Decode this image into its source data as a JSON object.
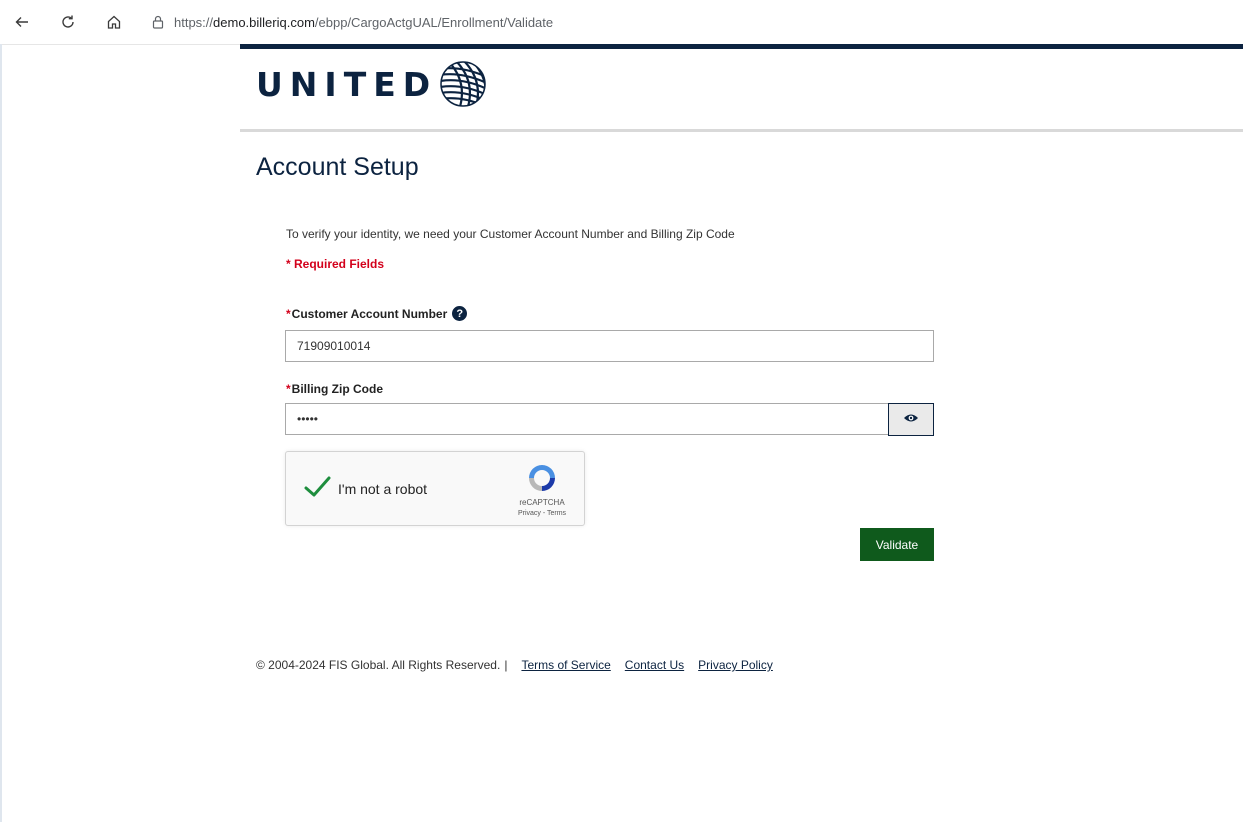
{
  "browser": {
    "url_prefix": "https://",
    "url_domain": "demo.billeriq.com",
    "url_path": "/ebpp/CargoActgUAL/Enrollment/Validate"
  },
  "brand": {
    "logo_text": "UNITED",
    "navy": "#0c2340",
    "required_red": "#d3001b",
    "validate_green": "#0f5a1c"
  },
  "page": {
    "title": "Account Setup",
    "intro": "To verify your identity, we need your Customer Account Number and Billing Zip Code",
    "required_note": "* Required Fields"
  },
  "form": {
    "account_number": {
      "star": "*",
      "label": "Customer Account Number",
      "value": "71909010014",
      "help_icon": "question-circle-icon"
    },
    "zip_code": {
      "star": "*",
      "label": "Billing Zip Code",
      "value": "•••••",
      "toggle_icon": "eye-icon"
    },
    "captcha": {
      "label": "I'm not a robot",
      "brand": "reCAPTCHA",
      "links": "Privacy - Terms",
      "checked": true
    },
    "submit_label": "Validate"
  },
  "footer": {
    "copyright": "© 2004-2024 FIS Global. All Rights Reserved.",
    "separator": "|",
    "links": [
      "Terms of Service",
      "Contact Us",
      "Privacy Policy"
    ]
  }
}
